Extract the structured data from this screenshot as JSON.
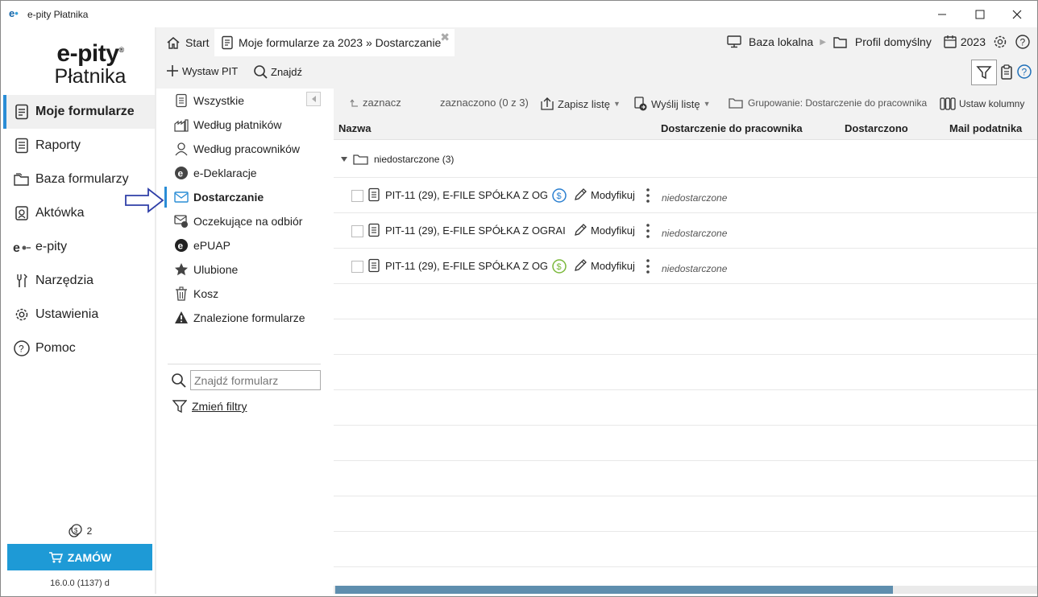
{
  "window": {
    "logo": "e",
    "title": "e-pity Płatnika",
    "minimize": "—",
    "maximize": "☐",
    "close": "✕"
  },
  "brand": {
    "line1": "e-pity",
    "line2": "Płatnika"
  },
  "sidebar": {
    "items": [
      {
        "label": "Moje formularze",
        "icon": "document-icon",
        "active": true
      },
      {
        "label": "Raporty",
        "icon": "report-icon"
      },
      {
        "label": "Baza formularzy",
        "icon": "folders-icon"
      },
      {
        "label": "Aktówka",
        "icon": "briefcase-icon"
      },
      {
        "label": "e-pity",
        "icon": "epity-logo-icon"
      },
      {
        "label": "Narzędzia",
        "icon": "tools-icon"
      },
      {
        "label": "Ustawienia",
        "icon": "gear-icon"
      },
      {
        "label": "Pomoc",
        "icon": "help-icon"
      }
    ],
    "credits": "2",
    "order_button": "ZAMÓW",
    "version": "16.0.0 (1137) d"
  },
  "tabs": {
    "start": "Start",
    "current": "Moje formularze za 2023 » Dostarczanie",
    "close": "✖"
  },
  "topright": {
    "database": "Baza lokalna",
    "profile": "Profil domyślny",
    "year": "2023"
  },
  "actions": {
    "new_pit": "Wystaw PIT",
    "find": "Znajdź"
  },
  "filters": {
    "items": [
      {
        "label": "Wszystkie",
        "icon": "document-icon"
      },
      {
        "label": "Według płatników",
        "icon": "factory-icon"
      },
      {
        "label": "Według pracowników",
        "icon": "person-icon"
      },
      {
        "label": "e-Deklaracje",
        "icon": "edeclaration-icon"
      },
      {
        "label": "Dostarczanie",
        "icon": "envelope-icon",
        "active": true
      },
      {
        "label": "Oczekujące na odbiór",
        "icon": "envelope-clock-icon"
      },
      {
        "label": "ePUAP",
        "icon": "epuap-icon"
      },
      {
        "label": "Ulubione",
        "icon": "star-icon"
      },
      {
        "label": "Kosz",
        "icon": "trash-icon"
      },
      {
        "label": "Znalezione formularze",
        "icon": "warning-icon"
      }
    ],
    "search_placeholder": "Znajdź formularz",
    "change_filters": "Zmień filtry"
  },
  "grid": {
    "toolbar": {
      "select": "zaznacz",
      "selected_count": "zaznaczono (0 z 3)",
      "save_list": "Zapisz listę",
      "send_list": "Wyślij listę",
      "grouping": "Grupowanie: Dostarczenie do pracownika",
      "set_columns": "Ustaw kolumny"
    },
    "columns": [
      "Nazwa",
      "Dostarczenie do pracownika",
      "Dostarczono",
      "Mail podatnika"
    ],
    "group": {
      "label": "niedostarczone (3)"
    },
    "rows": [
      {
        "name": "PIT-11 (29), E-FILE SPÓŁKA Z OG",
        "badge": "blue",
        "action": "Modyfikuj",
        "status": "niedostarczone"
      },
      {
        "name": "PIT-11 (29), E-FILE SPÓŁKA Z OGRAI",
        "badge": "none",
        "action": "Modyfikuj",
        "status": "niedostarczone"
      },
      {
        "name": "PIT-11 (29), E-FILE SPÓŁKA Z OG",
        "badge": "green",
        "action": "Modyfikuj",
        "status": "niedostarczone"
      }
    ]
  },
  "colors": {
    "accent": "#2a8dd6",
    "order_button": "#1e9ad6",
    "badge_blue": "#2a7fd0",
    "badge_green": "#7ab83a",
    "scrollbar": "#5e8eae"
  }
}
